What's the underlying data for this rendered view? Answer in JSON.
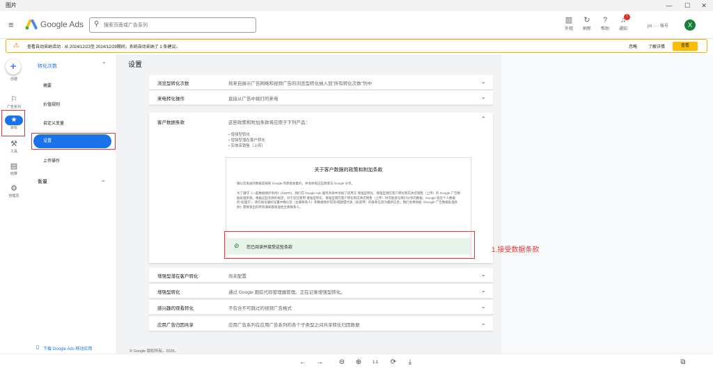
{
  "window": {
    "title": "图片",
    "minimize": "—",
    "maximize": "☐",
    "close": "✕"
  },
  "topbar": {
    "menu_glyph": "≡",
    "brand": "Google Ads",
    "search_placeholder": "搜索页面或广告系列",
    "tools": [
      {
        "label": "外观",
        "icon": "appearance-icon",
        "glyph": "▥"
      },
      {
        "label": "刷新",
        "icon": "refresh-icon",
        "glyph": "↻"
      },
      {
        "label": "帮助",
        "icon": "help-icon",
        "glyph": "?"
      },
      {
        "label": "通知",
        "icon": "bell-icon",
        "glyph": "♫"
      }
    ],
    "notif_count": "!",
    "account_text": "jm····· 帐号",
    "avatar_letter": "X"
  },
  "alert": {
    "icon_glyph": "⚠",
    "text": "查看自动采纳活动 · 从 2024/12/23至 2024/12/29期间，系统自动采纳了 1 条建议。",
    "ignore": "忽略",
    "learn_more": "了解详情",
    "view": "查看"
  },
  "rail": {
    "create": "创建",
    "campaigns": "广告系列",
    "goals": "目标",
    "tools": "工具",
    "billing": "结算",
    "admin": "管理员"
  },
  "subnav": {
    "section": "转化次数",
    "items": [
      "摘要",
      "价值规则",
      "自定义变量",
      "设置",
      "上传操作"
    ],
    "measure": "衡量",
    "mobile_link": "下载 Google Ads 移动应用"
  },
  "main": {
    "title": "设置",
    "rows_top": [
      {
        "label": "浏览型转化次数",
        "desc": "将来自展示广告网络和视频广告的浏览型转化纳入到\"所有转化次数\"列中"
      },
      {
        "label": "来电转化操作",
        "desc": "直接从广告中拨打的来电"
      }
    ],
    "customer_terms": {
      "label": "客户数据条款",
      "desc": "这些政策和附加条款将应用于下列产品：",
      "bullets": [
        "• 增强型转化",
        "• 增强型潜在客户转化",
        "• 实体店销售（上传）"
      ],
      "box_title": "关于客户数据的政策和附加条款",
      "p1": "确认您发送的数据是按照 Google 的政策收集的，并会依照这些政策与 Google 分享。",
      "p2": "为了遵守《一般数据保护条例》(GDPR)，我们在 Google Ads 服务条款中添加了适用于 增强型转化、增强型潜在客户转化和实体店销售（上传）的 Google 广告数据处理条款。根据这些条款的规定，对于您在使用 增强型转化、增强型潜在客户转化和实体店销售（上传）时可能会与我们分享的数据，Google 担任个人数据的\"处理方\"。请在账号偏好设置中确认您（主要联系人）和数据保护官及/或欧盟代表（如适用）的联系信息为最新信息。我们会将依据《Google 广告数据处理条款》需要发出的所有通知都发送给主要联系人。",
      "accept_glyph": "⊘",
      "accepted": "您已阅读并接受这些条款"
    },
    "rows_bottom": [
      {
        "label": "增强型潜在客户转化",
        "desc": "尚未配置"
      },
      {
        "label": "增强型转化",
        "desc": "通过 Google 跟踪代码管理器管理。正在记录增强型转化。"
      },
      {
        "label": "感兴趣的观看转化",
        "desc": "不包含不可跳过的视频广告格式"
      },
      {
        "label": "应用广告归因共享",
        "desc": "应用广告系列在应用广告系列的各个子类型之间共享转化归因数据"
      }
    ],
    "copyright": "© Google 版权所有。2025。"
  },
  "annotation": "1.接受数据条款",
  "viewer": [
    {
      "name": "prev-icon",
      "glyph": "←"
    },
    {
      "name": "next-icon",
      "glyph": "→"
    },
    {
      "name": "zoom-out-icon",
      "glyph": "⊖"
    },
    {
      "name": "zoom-in-icon",
      "glyph": "⊕"
    },
    {
      "name": "actual-size-icon",
      "glyph": "1:1"
    },
    {
      "name": "rotate-icon",
      "glyph": "⟳"
    },
    {
      "name": "download-icon",
      "glyph": "⤓"
    }
  ],
  "viewer_right": "⧉",
  "colors": {
    "primary": "#1a73e8",
    "annotation_red": "#e53935",
    "accept_bg": "#e6f4ea",
    "alert_border": "#f9ab00"
  }
}
